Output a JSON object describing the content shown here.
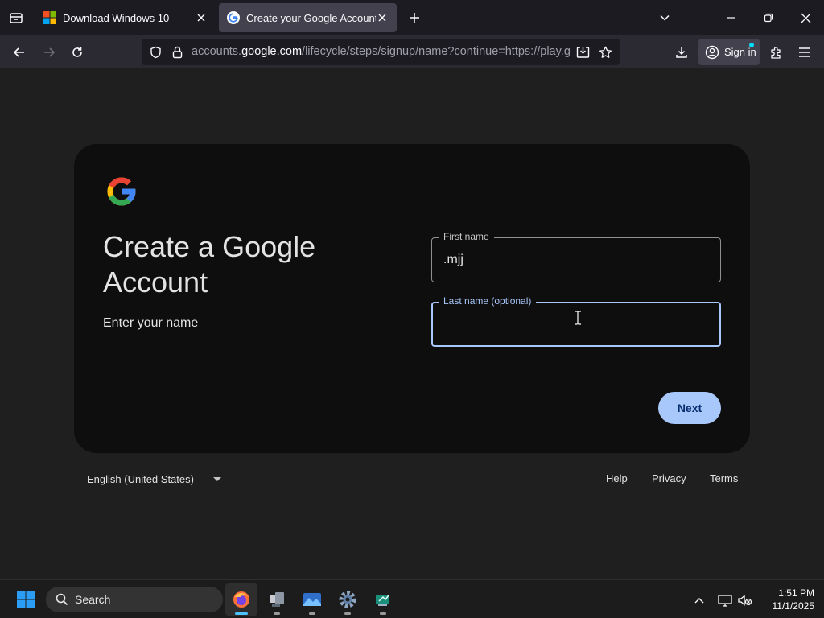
{
  "browser": {
    "tabs": [
      {
        "title": "Download Windows 10",
        "active": false
      },
      {
        "title": "Create your Google Account",
        "active": true
      }
    ],
    "url": {
      "prefix": "accounts.",
      "host": "google.com",
      "path": "/lifecycle/steps/signup/name?continue=https://play.goo"
    },
    "sign_in_label": "Sign in"
  },
  "page": {
    "heading": "Create a Google Account",
    "subheading": "Enter your name",
    "first_name": {
      "label": "First name",
      "value": ".mjj"
    },
    "last_name": {
      "label": "Last name (optional)",
      "value": ""
    },
    "next_label": "Next",
    "footer": {
      "language": "English (United States)",
      "links": [
        "Help",
        "Privacy",
        "Terms"
      ]
    }
  },
  "taskbar": {
    "search_label": "Search",
    "time": "1:51 PM",
    "date": "11/1/2025"
  },
  "colors": {
    "accent": "#a8c7fa",
    "google_blue": "#4285f4",
    "google_red": "#ea4335",
    "google_yellow": "#fbbc05",
    "google_green": "#34a853"
  }
}
